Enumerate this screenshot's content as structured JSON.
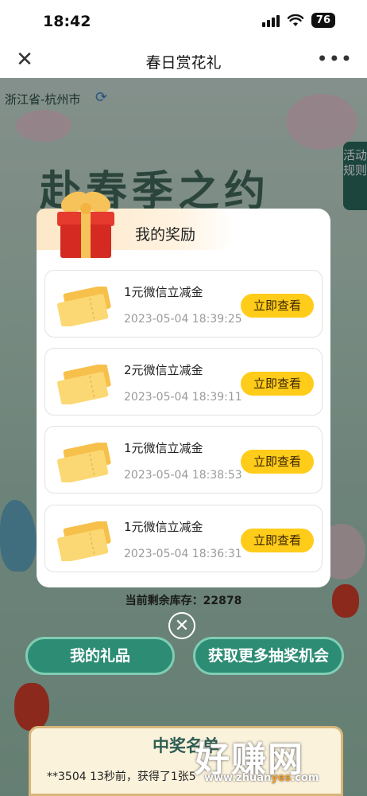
{
  "status_bar": {
    "time": "18:42",
    "battery": "76"
  },
  "nav": {
    "close_icon": "close-icon",
    "title": "春日赏花礼",
    "more_icon": "more-icon"
  },
  "page": {
    "location": "浙江省-杭州市",
    "rules_label": "活动规则",
    "banner_text": "赴春季之约",
    "stock_text": "当前剩余库存：22878",
    "my_gifts_button": "我的礼品",
    "more_chances_button": "获取更多抽奖机会",
    "winners_title": "中奖名单",
    "winners_line": "**3504 13秒前，获得了1张5",
    "watermark_main": "好赚网",
    "watermark_domain_prefix": "www.zhuan",
    "watermark_domain_accent": "yes",
    "watermark_domain_suffix": ".com"
  },
  "modal": {
    "title": "我的奖励",
    "rewards": [
      {
        "name": "1元微信立减金",
        "time": "2023-05-04 18:39:25",
        "button": "立即查看"
      },
      {
        "name": "2元微信立减金",
        "time": "2023-05-04 18:39:11",
        "button": "立即查看"
      },
      {
        "name": "1元微信立减金",
        "time": "2023-05-04 18:38:53",
        "button": "立即查看"
      },
      {
        "name": "1元微信立减金",
        "time": "2023-05-04 18:36:31",
        "button": "立即查看"
      }
    ]
  },
  "colors": {
    "accent_yellow": "#ffcc1a",
    "green_button": "#2c8c74",
    "header_peach": "#fde7c7"
  }
}
